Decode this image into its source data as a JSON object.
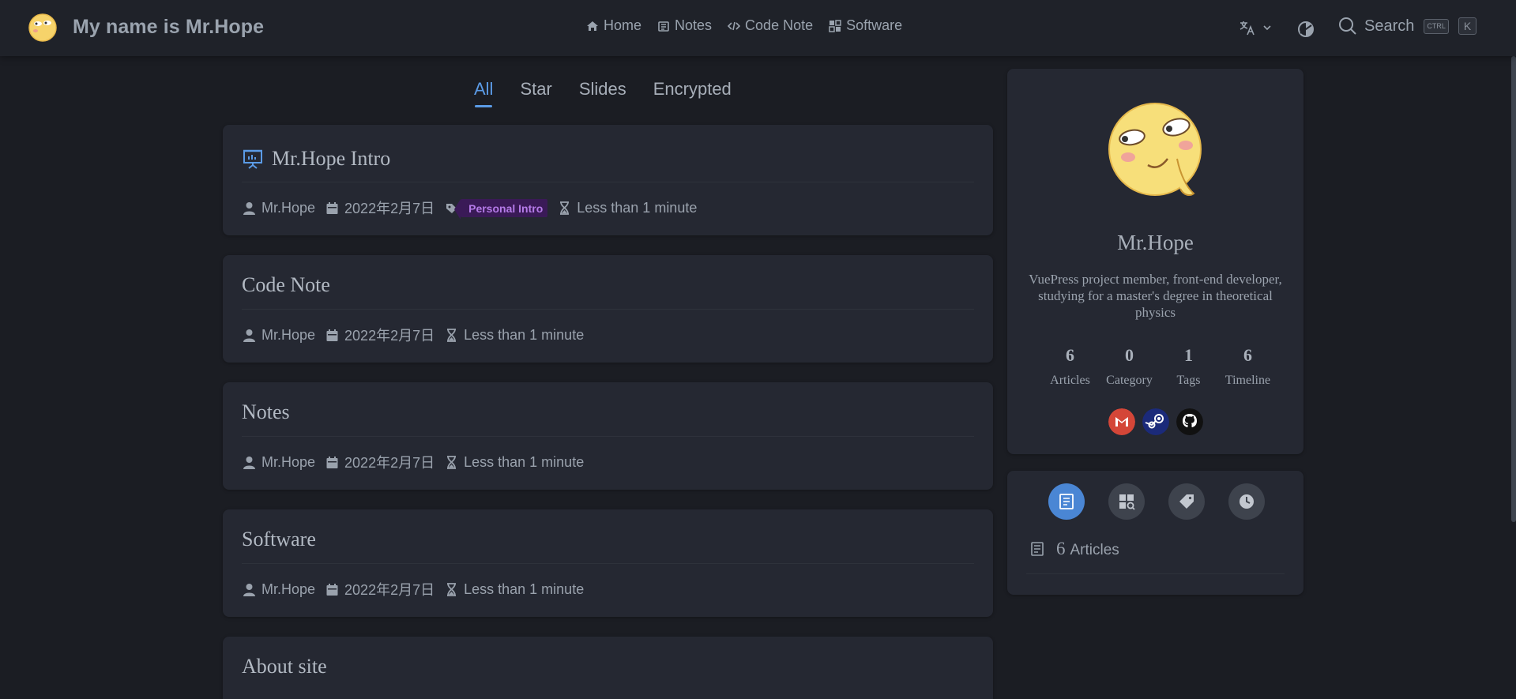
{
  "navbar": {
    "brand_title": "My name is Mr.Hope",
    "links": [
      {
        "label": "Home",
        "icon": "home-icon"
      },
      {
        "label": "Notes",
        "icon": "notes-icon"
      },
      {
        "label": "Code Note",
        "icon": "code-icon"
      },
      {
        "label": "Software",
        "icon": "software-icon"
      }
    ],
    "search_placeholder": "Search",
    "search_keys": [
      "CTRL",
      "K"
    ]
  },
  "tabs": [
    {
      "label": "All",
      "active": true
    },
    {
      "label": "Star",
      "active": false
    },
    {
      "label": "Slides",
      "active": false
    },
    {
      "label": "Encrypted",
      "active": false
    }
  ],
  "articles": [
    {
      "title": "Mr.Hope Intro",
      "title_icon": "slides-icon",
      "author": "Mr.Hope",
      "date": "2022年2月7日",
      "tag": "Personal Intro",
      "reading_time": "Less than 1 minute"
    },
    {
      "title": "Code Note",
      "author": "Mr.Hope",
      "date": "2022年2月7日",
      "reading_time": "Less than 1 minute"
    },
    {
      "title": "Notes",
      "author": "Mr.Hope",
      "date": "2022年2月7日",
      "reading_time": "Less than 1 minute"
    },
    {
      "title": "Software",
      "author": "Mr.Hope",
      "date": "2022年2月7日",
      "reading_time": "Less than 1 minute"
    },
    {
      "title": "About site"
    }
  ],
  "profile": {
    "name": "Mr.Hope",
    "description": "VuePress project member, front-end developer, studying for a master's degree in theoretical physics",
    "stats": [
      {
        "value": "6",
        "label": "Articles"
      },
      {
        "value": "0",
        "label": "Category"
      },
      {
        "value": "1",
        "label": "Tags"
      },
      {
        "value": "6",
        "label": "Timeline"
      }
    ],
    "socials": [
      {
        "icon": "gmail-icon",
        "color": "#d44638"
      },
      {
        "icon": "steam-icon",
        "color": "#1b2a7a"
      },
      {
        "icon": "github-icon",
        "color": "#111111"
      }
    ]
  },
  "info_panel": {
    "buttons": [
      "article-list-icon",
      "category-icon",
      "tag-icon",
      "timeline-icon"
    ],
    "summary_count": "6",
    "summary_label": "Articles"
  },
  "colors": {
    "accent": "#5b9be6",
    "background": "#1b1d23",
    "card": "#252832",
    "tag_bg": "#3a1a57",
    "tag_text": "#b57be8"
  }
}
